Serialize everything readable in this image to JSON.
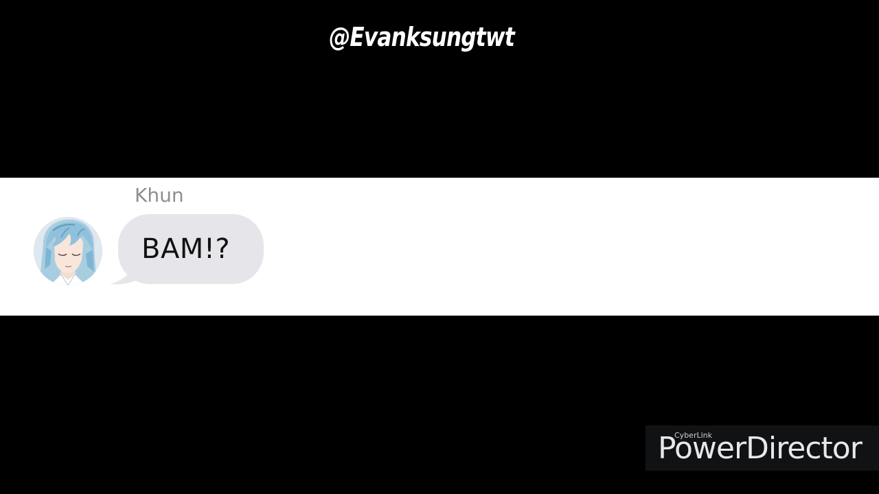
{
  "overlay": {
    "handle": "@Evanksungtwt"
  },
  "chat": {
    "sender_name": "Khun",
    "message": "BAM!?",
    "avatar_icon": "character-portrait-avatar",
    "bubble_color": "#e5e5ea",
    "name_color": "#8e8e8e"
  },
  "watermark": {
    "brand_small": "CyberLink",
    "brand_large": "PowerDirector"
  },
  "colors": {
    "background": "#000000",
    "chat_background": "#ffffff",
    "handle_text": "#ffffff"
  }
}
